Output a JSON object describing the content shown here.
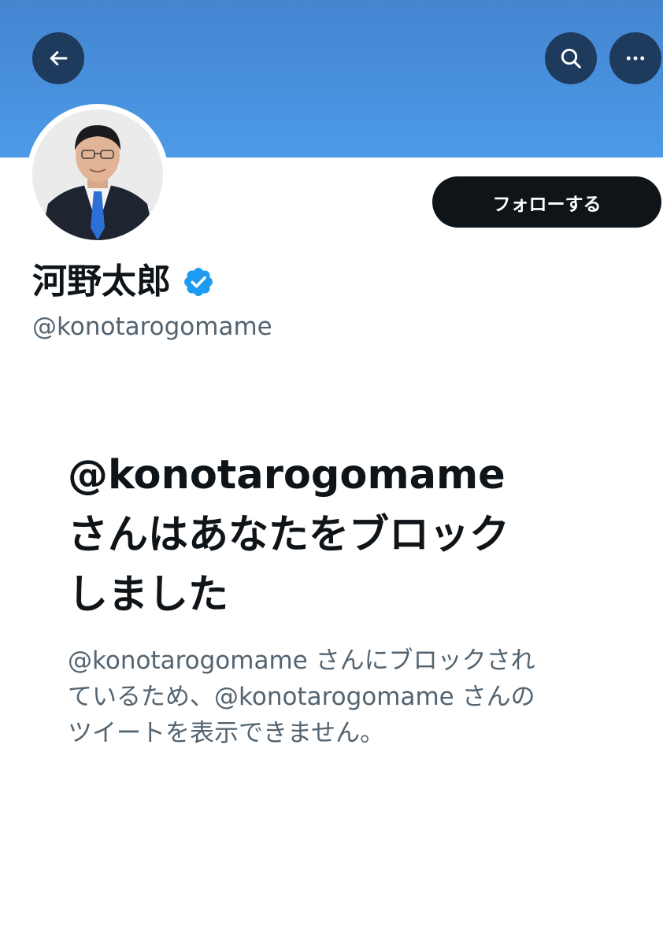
{
  "header": {
    "back_icon": "arrow-left-icon",
    "search_icon": "search-icon",
    "more_icon": "more-horizontal-icon",
    "banner_color": "#4a92e0",
    "button_bg": "#1e3a5c"
  },
  "profile": {
    "display_name": "河野太郎",
    "verified": true,
    "verified_icon": "verified-badge-icon",
    "verified_color": "#1d9bf0",
    "handle": "@konotarogomame",
    "follow_label": "フォローする"
  },
  "block_notice": {
    "title_line1": "@konotarogomame",
    "title_line2": "さんはあなたをブロック",
    "title_line3": "しました",
    "desc_line1": "@konotarogomame さんにブロックされ",
    "desc_line2": "ているため、@konotarogomame さんの",
    "desc_line3": "ツイートを表示できません。"
  }
}
